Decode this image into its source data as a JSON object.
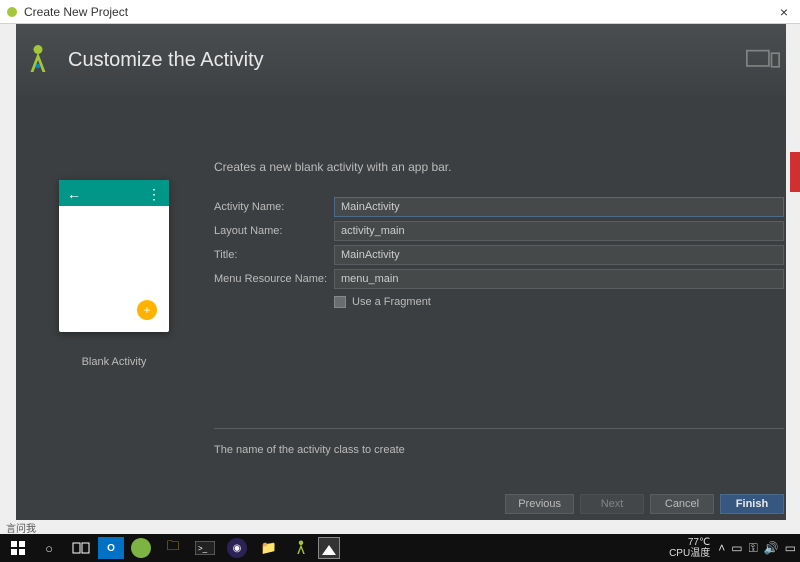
{
  "window": {
    "title": "Create New Project"
  },
  "header": {
    "title": "Customize the Activity"
  },
  "description": "Creates a new blank activity with an app bar.",
  "preview": {
    "caption": "Blank Activity",
    "fab": "+"
  },
  "form": {
    "activity_name": {
      "label": "Activity Name:",
      "value": "MainActivity"
    },
    "layout_name": {
      "label": "Layout Name:",
      "value": "activity_main"
    },
    "title": {
      "label": "Title:",
      "value": "MainActivity"
    },
    "menu_resource": {
      "label": "Menu Resource Name:",
      "value": "menu_main"
    },
    "use_fragment": {
      "label": "Use a Fragment"
    }
  },
  "hint": "The name of the activity class to create",
  "buttons": {
    "previous": "Previous",
    "next": "Next",
    "cancel": "Cancel",
    "finish": "Finish"
  },
  "taskbar": {
    "temp": "77℃",
    "temp_label": "CPU温度",
    "bottom_label": "言问我"
  }
}
